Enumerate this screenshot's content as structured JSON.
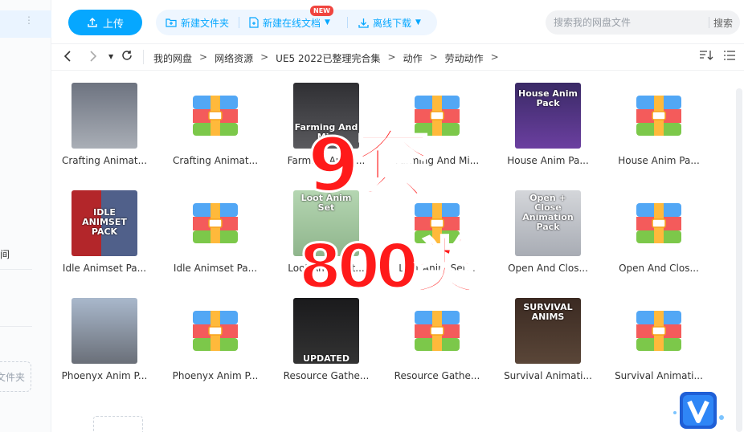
{
  "sidebar": {
    "fragment_text": "间",
    "folder_fragment": "文件夹"
  },
  "toolbar": {
    "upload_label": "上传",
    "new_folder_label": "新建文件夹",
    "new_online_doc_label": "新建在线文档",
    "new_badge": "NEW",
    "offline_download_label": "离线下载",
    "search_placeholder": "搜索我的网盘文件",
    "search_button": "搜索"
  },
  "breadcrumb": [
    "我的网盘",
    "网络资源",
    "UE5 2022已整理完合集",
    "动作",
    "劳动动作"
  ],
  "files": [
    {
      "name": "Crafting Animat...",
      "type": "image",
      "thumb": "gray",
      "thumb_text": ""
    },
    {
      "name": "Crafting Animat...",
      "type": "archive",
      "thumb": "rar",
      "thumb_text": ""
    },
    {
      "name": "Farming An Mi...",
      "type": "image",
      "thumb": "dark",
      "thumb_text": "Farming And Min"
    },
    {
      "name": "Farming And Mi...",
      "type": "archive",
      "thumb": "rar",
      "thumb_text": ""
    },
    {
      "name": "House Anim Pa...",
      "type": "image",
      "thumb": "purple",
      "thumb_text": "House Anim Pack"
    },
    {
      "name": "House Anim Pa...",
      "type": "archive",
      "thumb": "rar",
      "thumb_text": ""
    },
    {
      "name": "Idle Animset Pa...",
      "type": "image",
      "thumb": "red",
      "thumb_text": "IDLE ANIMSET PACK"
    },
    {
      "name": "Idle Animset Pa...",
      "type": "archive",
      "thumb": "rar",
      "thumb_text": ""
    },
    {
      "name": "Loot Anim Set...",
      "type": "image",
      "thumb": "green",
      "thumb_text": "Loot Anim Set"
    },
    {
      "name": "Loot Anim Set...",
      "type": "archive",
      "thumb": "rar",
      "thumb_text": ""
    },
    {
      "name": "Open And Clos...",
      "type": "image",
      "thumb": "light",
      "thumb_text": "Open + Close Animation Pack"
    },
    {
      "name": "Open And Clos...",
      "type": "archive",
      "thumb": "rar",
      "thumb_text": ""
    },
    {
      "name": "Phoenyx Anim P...",
      "type": "image",
      "thumb": "sky",
      "thumb_text": ""
    },
    {
      "name": "Phoenyx Anim P...",
      "type": "archive",
      "thumb": "rar",
      "thumb_text": ""
    },
    {
      "name": "Resource Gathe...",
      "type": "image",
      "thumb": "black",
      "thumb_text": "UPDATED"
    },
    {
      "name": "Resource Gathe...",
      "type": "archive",
      "thumb": "rar",
      "thumb_text": ""
    },
    {
      "name": "Survival Animati...",
      "type": "image",
      "thumb": "brown",
      "thumb_text": "SURVIVAL ANIMS"
    },
    {
      "name": "Survival Animati...",
      "type": "archive",
      "thumb": "rar",
      "thumb_text": ""
    }
  ],
  "overlay": {
    "line1": "9套",
    "line2": "800类"
  },
  "colors": {
    "accent": "#06a7ff",
    "overlay_red": "#ff1a1a",
    "badge_red": "#f0453f"
  },
  "icons": {
    "upload": "upload-icon",
    "new_folder": "folder-plus-icon",
    "new_doc": "document-plus-icon",
    "download": "download-icon",
    "back": "chevron-left-icon",
    "forward": "chevron-right-icon",
    "history": "caret-down-icon",
    "refresh": "refresh-icon",
    "sort": "sort-icon",
    "view": "list-view-icon"
  }
}
